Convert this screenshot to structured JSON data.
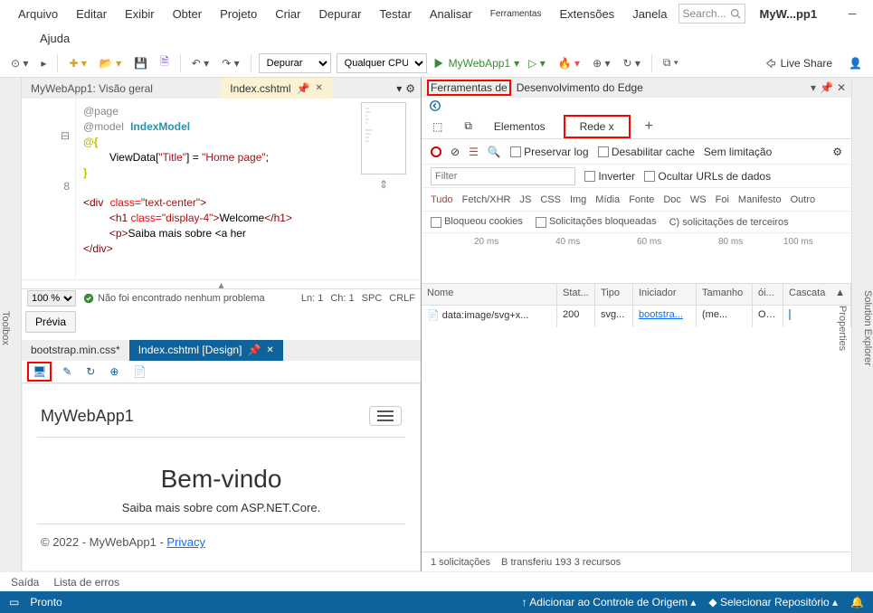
{
  "menu": {
    "file": "Arquivo",
    "edit": "Editar",
    "view": "Exibir",
    "get": "Obter",
    "project": "Projeto",
    "create": "Criar",
    "debug": "Depurar",
    "test": "Testar",
    "analyze": "Analisar",
    "tools": "Ferramentas",
    "extensions": "Extensões",
    "window": "Janela",
    "help": "Ajuda"
  },
  "title": "MyW...pp1",
  "search_placeholder": "Search...",
  "toolbar": {
    "config": "Depurar",
    "platform": "Qualquer CPU",
    "run_target": "MyWebApp1",
    "live_share": "Live Share"
  },
  "left_rail": "Toolbox",
  "right_rail": {
    "sol": "Solution Explorer",
    "prop": "Properties"
  },
  "tabs": {
    "overview": "MyWebApp1: Visão geral",
    "index": "Index.cshtml"
  },
  "code": {
    "page": "@page",
    "model_kw": "@model",
    "model_type": "IndexModel",
    "at": "@",
    "brace_open": "{",
    "brace_close": "}",
    "viewdata": "ViewData[",
    "title_key": "\"Title\"",
    "eq": "] = ",
    "title_val": "\"Home page\"",
    "semi": ";",
    "line8": "8",
    "div_open": "<div",
    "div_class_attr": "class=",
    "div_class_val": "\"text-center\"",
    "gt": ">",
    "h1_open": "<h1 ",
    "h1_class_val": "\"display-4\"",
    "h1_text": "Welcome",
    "h1_close": "</h1>",
    "p_open": "<p>",
    "p_text": "Saiba mais sobre <a her",
    "div_close": "</div>"
  },
  "status_mini": {
    "zoom": "100 %",
    "no_issues": "Não foi encontrado nenhum problema",
    "ln": "Ln: 1",
    "ch": "Ch: 1",
    "spc": "SPC",
    "crlf": "CRLF"
  },
  "preview_btn": "Prévia",
  "design_tabs": {
    "css": "bootstrap.min.css*",
    "design": "Index.cshtml [Design]"
  },
  "preview": {
    "brand": "MyWebApp1",
    "heading": "Bem-vindo",
    "sub": "Saiba mais sobre com ASP.NET.Core.",
    "footer_text": "© 2022 - MyWebApp1 - ",
    "footer_link": "Privacy"
  },
  "devtools": {
    "title_pre": "Ferramentas de",
    "title_post": " Desenvolvimento do Edge",
    "tab_elements": "Elementos",
    "tab_network": "Rede x",
    "preserve_log": "Preservar log",
    "disable_cache": "Desabilitar cache",
    "no_throttle": "Sem limitação",
    "filter_placeholder": "Filter",
    "invert": "Inverter",
    "hide_data": "Ocultar URLs de dados",
    "types": {
      "all": "Tudo",
      "fetch": "Fetch/XHR",
      "js": "JS",
      "css": "CSS",
      "img": "Img",
      "media": "Mídia",
      "font": "Fonte",
      "doc": "Doc",
      "ws": "WS",
      "foi": "Foi",
      "manifest": "Manifesto",
      "other": "Outro"
    },
    "blocked_cookies": "Bloqueou cookies",
    "blocked_req": "Solicitações bloqueadas",
    "third_party": "C) solicitações de terceiros",
    "timeline": {
      "t1": "20 ms",
      "t2": "40 ms",
      "t3": "60 ms",
      "t4": "80 ms",
      "t5": "100 ms"
    },
    "cols": {
      "name": "Nome",
      "status": "Stat...",
      "type": "Tipo",
      "init": "Iniciador",
      "size": "Tamanho",
      "time": "ói...",
      "waterfall": "Cascata"
    },
    "row": {
      "name": "data:image/svg+x...",
      "status": "200",
      "type": "svg...",
      "init": "bootstra...",
      "size": "(me...",
      "time": "Oms"
    },
    "summary": {
      "req": "1 solicitações",
      "xfer": "B transferiu 193 3 recursos"
    }
  },
  "bottom": {
    "output": "Saída",
    "errors": "Lista de erros"
  },
  "statusbar": {
    "ready": "Pronto",
    "src_ctl": "Adicionar ao Controle de Origem",
    "repo": "Selecionar Repositório"
  }
}
